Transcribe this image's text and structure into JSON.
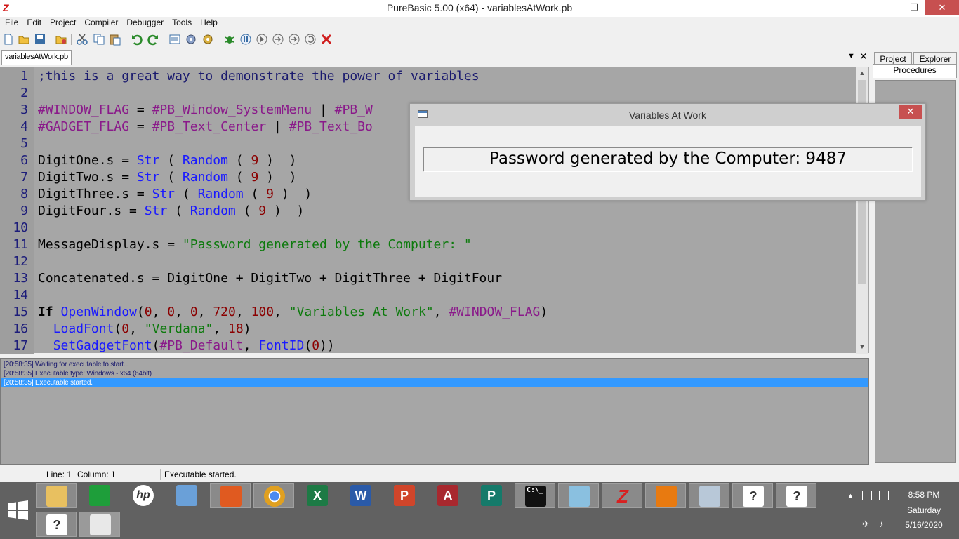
{
  "window": {
    "title": "PureBasic 5.00 (x64) - variablesAtWork.pb",
    "min_glyph": "—",
    "max_glyph": "❐",
    "close_glyph": "✕"
  },
  "menu": [
    "File",
    "Edit",
    "Project",
    "Compiler",
    "Debugger",
    "Tools",
    "Help"
  ],
  "toolbar_icons": [
    "new-file-icon",
    "open-file-icon",
    "save-icon",
    "save-all-icon",
    "cut-icon",
    "copy-icon",
    "paste-icon",
    "undo-icon",
    "redo-icon",
    "procedure-browser-icon",
    "compile-run-icon",
    "compiler-options-icon",
    "debugger-icon",
    "stop-icon",
    "step-icon",
    "step-over-icon",
    "step-out-icon",
    "kill-program-icon"
  ],
  "tabs": {
    "file_tab": "variablesAtWork.pb",
    "menu_glyph": "▼",
    "close_glyph": "✕"
  },
  "editor": {
    "line_numbers": [
      "1",
      "2",
      "3",
      "4",
      "5",
      "6",
      "7",
      "8",
      "9",
      "10",
      "11",
      "12",
      "13",
      "14",
      "15",
      "16",
      "17"
    ],
    "code": {
      "l1": ";this is a great way to demonstrate the power of variables",
      "l3_a": "#WINDOW_FLAG",
      "l3_b": " = ",
      "l3_c": "#PB_Window_SystemMenu",
      "l3_d": " | ",
      "l3_e": "#PB_W",
      "l4_a": "#GADGET_FLAG",
      "l4_b": " = ",
      "l4_c": "#PB_Text_Center",
      "l4_d": " | ",
      "l4_e": "#PB_Text_Bo",
      "l6_a": "DigitOne.s = ",
      "l7_a": "DigitTwo.s = ",
      "l8_a": "DigitThree.s = ",
      "l9_a": "DigitFour.s = ",
      "str_fn": "Str",
      "random_fn": "Random",
      "open_paren": " ( ",
      "close_paren": " ) ",
      "close_paren_end": " )",
      "nine": "9",
      "l11_a": "MessageDisplay.s = ",
      "l11_b": "\"Password generated by the Computer: \"",
      "l13": "Concatenated.s = DigitOne + DigitTwo + DigitThree + DigitFour",
      "l15_if": "If",
      "l15_fn": "OpenWindow",
      "l15_p1": "(",
      "l15_n0": "0",
      "l15_c1": ", ",
      "l15_n720": "720",
      "l15_n100": "100",
      "l15_str": "\"Variables At Work\"",
      "l15_const": "#WINDOW_FLAG",
      "l15_end": ")",
      "l16_fn": "LoadFont",
      "l16_str": "\"Verdana\"",
      "l16_n18": "18",
      "l17_fn": "SetGadgetFont",
      "l17_const": "#PB_Default",
      "l17_fn2": "FontID",
      "l17_end": "))"
    }
  },
  "output": {
    "lines": [
      "[20:58:35] Waiting for executable to start...",
      "[20:58:35] Executable type: Windows - x64  (64bit)",
      "[20:58:35] Executable started."
    ],
    "selected_index": 2
  },
  "right_panel": {
    "tab_project": "Project",
    "tab_explorer": "Explorer",
    "tab_procedures": "Procedures"
  },
  "statusbar": {
    "line": "Line: 1",
    "column": "Column: 1",
    "message": "Executable started."
  },
  "dialog": {
    "title": "Variables At Work",
    "close_glyph": "✕",
    "text": "Password generated by the Computer: 9487"
  },
  "taskbar": {
    "apps": [
      "file-explorer-icon",
      "store-icon",
      "hp-icon",
      "control-panel-icon",
      "office-icon",
      "chrome-icon",
      "excel-icon",
      "word-icon",
      "powerpoint-icon",
      "access-icon",
      "publisher-icon",
      "cmd-icon",
      "notepad-icon",
      "purebasic-icon",
      "media-player-icon",
      "task-manager-icon",
      "help-icon",
      "help-icon-2"
    ],
    "app_labels": {
      "hp": "hp",
      "excel": "X",
      "word": "W",
      "powerpoint": "P",
      "access": "A",
      "publisher": "P",
      "cmd": "C:\\_",
      "purebasic": "Z",
      "help": "?"
    },
    "tray_up": "▲",
    "tray_wifi_glyph": "✈",
    "tray_volume_glyph": "♪",
    "time": "8:58 PM",
    "day": "Saturday",
    "date": "5/16/2020"
  }
}
